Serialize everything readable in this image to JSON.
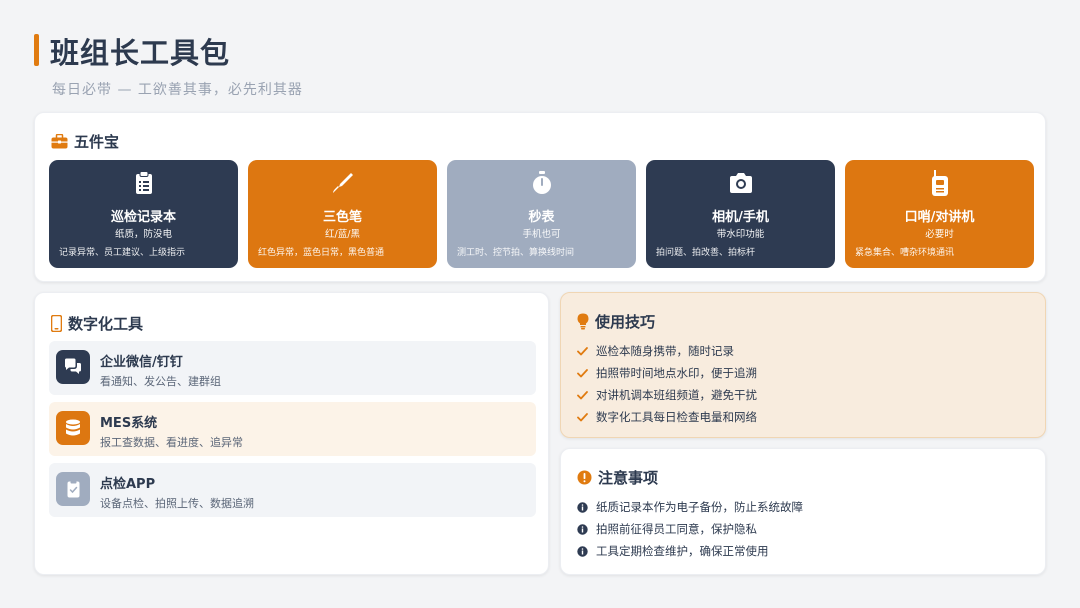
{
  "header": {
    "title": "班组长工具包",
    "subtitle": "每日必带 — 工欲善其事，必先利其器"
  },
  "tools_section": {
    "title": "五件宝",
    "icon": "toolbox-icon",
    "items": [
      {
        "name": "巡检记录本",
        "sub": "纸质，防没电",
        "desc": "记录异常、员工建议、上级指示",
        "icon": "clipboard-icon",
        "color": "#2e3b52"
      },
      {
        "name": "三色笔",
        "sub": "红/蓝/黑",
        "desc": "红色异常，蓝色日常，黑色普通",
        "icon": "pen-icon",
        "color": "#dd7711"
      },
      {
        "name": "秒表",
        "sub": "手机也可",
        "desc": "测工时、控节拍、算换线时间",
        "icon": "stopwatch-icon",
        "color": "#a0acbf"
      },
      {
        "name": "相机/手机",
        "sub": "带水印功能",
        "desc": "拍问题、拍改善、拍标杆",
        "icon": "camera-icon",
        "color": "#2e3b52"
      },
      {
        "name": "口哨/对讲机",
        "sub": "必要时",
        "desc": "紧急集合、嘈杂环境通讯",
        "icon": "walkie-talkie-icon",
        "color": "#dd7711"
      }
    ]
  },
  "digital_section": {
    "title": "数字化工具",
    "icon": "mobile-icon",
    "items": [
      {
        "name": "企业微信/钉钉",
        "desc": "看通知、发公告、建群组",
        "icon": "chat-icon"
      },
      {
        "name": "MES系统",
        "desc": "报工查数据、看进度、追异常",
        "icon": "database-icon"
      },
      {
        "name": "点检APP",
        "desc": "设备点检、拍照上传、数据追溯",
        "icon": "check-file-icon"
      }
    ]
  },
  "tips_section": {
    "title": "使用技巧",
    "icon": "lightbulb-icon",
    "items": [
      "巡检本随身携带，随时记录",
      "拍照带时间地点水印，便于追溯",
      "对讲机调本班组频道，避免干扰",
      "数字化工具每日检查电量和网络"
    ]
  },
  "notes_section": {
    "title": "注意事项",
    "icon": "warning-icon",
    "items": [
      "纸质记录本作为电子备份，防止系统故障",
      "拍照前征得员工同意，保护隐私",
      "工具定期检查维护，确保正常使用"
    ]
  },
  "colors": {
    "accent": "#e07b10",
    "navy": "#2e3b52",
    "gray": "#a0acbf",
    "text": "#2d3a4f"
  }
}
